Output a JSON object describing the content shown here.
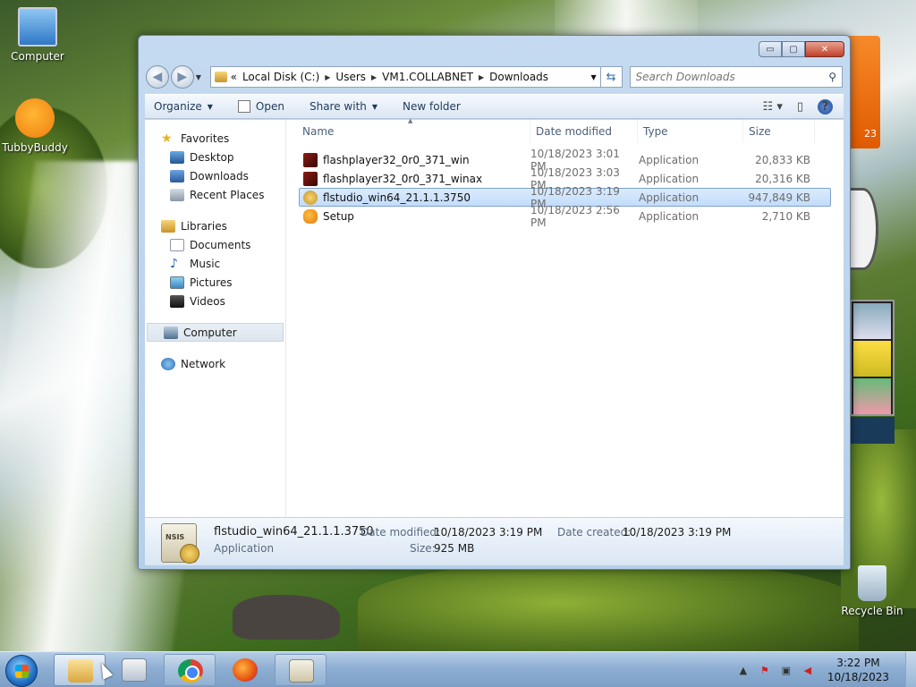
{
  "desktop": {
    "icons": [
      {
        "label": "Computer"
      },
      {
        "label": "TubbyBuddy"
      },
      {
        "label": "Recycle Bin"
      }
    ],
    "calendar_gadget_text": "23"
  },
  "window": {
    "caption": {
      "minimize": "▭",
      "maximize": "▢",
      "close": "✕"
    },
    "address": {
      "chevron": "«",
      "crumbs": [
        "Local Disk (C:)",
        "Users",
        "VM1.COLLABNET",
        "Downloads"
      ]
    },
    "search": {
      "placeholder": "Search Downloads"
    },
    "toolbar": {
      "organize": "Organize",
      "open": "Open",
      "share_with": "Share with",
      "new_folder": "New folder"
    },
    "nav": {
      "favorites": "Favorites",
      "favorites_items": [
        "Desktop",
        "Downloads",
        "Recent Places"
      ],
      "libraries": "Libraries",
      "libraries_items": [
        "Documents",
        "Music",
        "Pictures",
        "Videos"
      ],
      "computer": "Computer",
      "network": "Network"
    },
    "columns": {
      "name": "Name",
      "date": "Date modified",
      "type": "Type",
      "size": "Size"
    },
    "files": [
      {
        "name": "flashplayer32_0r0_371_win",
        "date": "10/18/2023 3:01 PM",
        "type": "Application",
        "size": "20,833 KB",
        "icon": "flash-icon"
      },
      {
        "name": "flashplayer32_0r0_371_winax",
        "date": "10/18/2023 3:03 PM",
        "type": "Application",
        "size": "20,316 KB",
        "icon": "flash-icon"
      },
      {
        "name": "flstudio_win64_21.1.1.3750",
        "date": "10/18/2023 3:19 PM",
        "type": "Application",
        "size": "947,849 KB",
        "icon": "nsis-installer-icon"
      },
      {
        "name": "Setup",
        "date": "10/18/2023 2:56 PM",
        "type": "Application",
        "size": "2,710 KB",
        "icon": "setup-icon"
      }
    ],
    "details": {
      "icon_label": "NSIS",
      "name": "flstudio_win64_21.1.1.3750",
      "type": "Application",
      "date_modified_label": "Date modified:",
      "date_modified": "10/18/2023 3:19 PM",
      "date_created_label": "Date created:",
      "date_created": "10/18/2023 3:19 PM",
      "size_label": "Size:",
      "size": "925 MB"
    }
  },
  "taskbar": {
    "time": "3:22 PM",
    "date": "10/18/2023"
  }
}
